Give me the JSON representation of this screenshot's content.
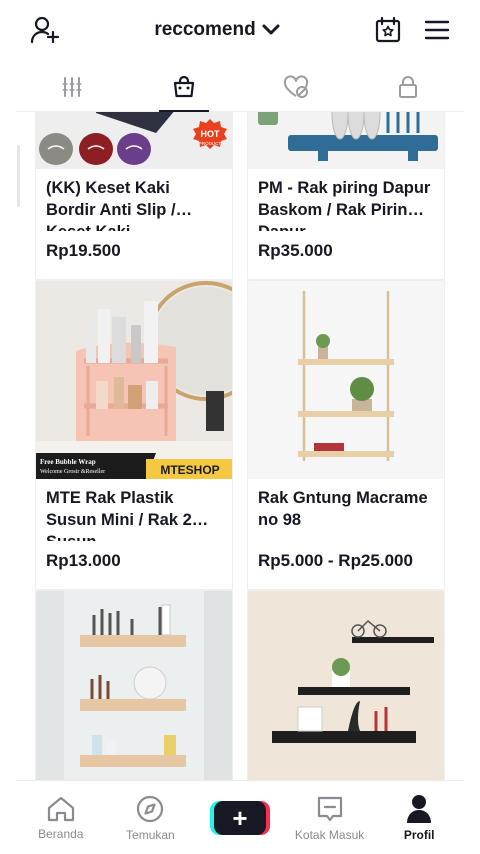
{
  "header": {
    "title": "reccomend",
    "icons": [
      "add-user-icon",
      "chevron-down-icon",
      "calendar-star-icon",
      "menu-icon"
    ]
  },
  "tabs": [
    {
      "icon": "grid-icon",
      "active": false
    },
    {
      "icon": "shopping-bag-icon",
      "active": true
    },
    {
      "icon": "liked-hidden-icon",
      "active": false
    },
    {
      "icon": "lock-icon",
      "active": false
    }
  ],
  "products": [
    {
      "name": "(KK) Keset Kaki Bordir Anti Slip / Keset Kaki",
      "price": "Rp19.500",
      "badge": "HOT PRODUCT"
    },
    {
      "name": "PM - Rak piring Dapur Baskom / Rak Piring Dapur",
      "price": "Rp35.000"
    },
    {
      "name": "MTE Rak Plastik Susun Mini / Rak 2 Susun",
      "price": "Rp13.000",
      "banner_text": "Free Bubble Wrap",
      "banner_sub": "Welcome Grosir &Reseller",
      "brand": "MTESHOP"
    },
    {
      "name": "Rak Gntung Macrame no 98",
      "price": "Rp5.000 - Rp25.000"
    },
    {
      "name": "",
      "price": ""
    },
    {
      "name": "",
      "price": ""
    }
  ],
  "bottom_nav": [
    {
      "label": "Beranda",
      "icon": "home-icon"
    },
    {
      "label": "Temukan",
      "icon": "compass-icon"
    },
    {
      "label": "",
      "icon": "plus-icon"
    },
    {
      "label": "Kotak Masuk",
      "icon": "inbox-icon"
    },
    {
      "label": "Profil",
      "icon": "profile-icon",
      "active": true
    }
  ],
  "colors": {
    "text": "#161823",
    "muted": "#8a8b91",
    "accent_cyan": "#25f4ee",
    "accent_red": "#fe2c55"
  }
}
